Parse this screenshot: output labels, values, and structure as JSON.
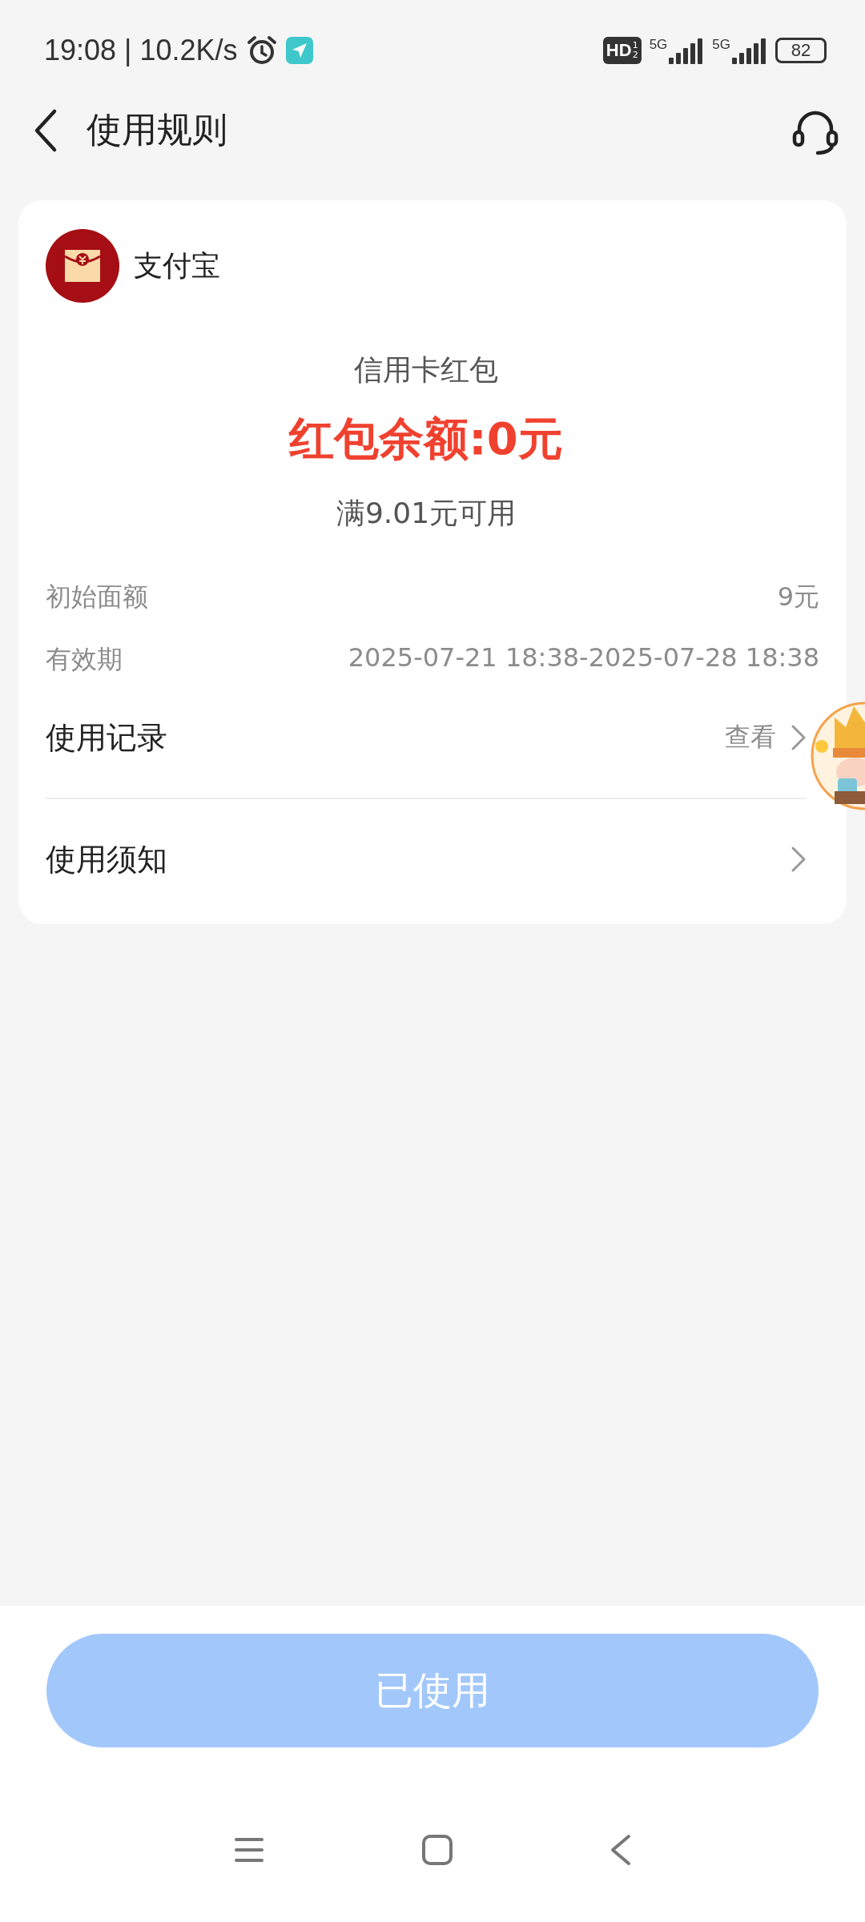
{
  "status_bar": {
    "time": "19:08 | 10.2K/s",
    "hd_badge": {
      "label": "HD",
      "sims": [
        "1",
        "2"
      ]
    },
    "networks": [
      {
        "label": "5G"
      },
      {
        "label": "5G"
      }
    ],
    "battery": "82"
  },
  "header": {
    "title": "使用规则"
  },
  "card": {
    "merchant": "支付宝",
    "coupon_type": "信用卡红包",
    "balance": "红包余额:0元",
    "condition": "满9.01元可用",
    "details": [
      {
        "label": "初始面额",
        "value": "9元"
      },
      {
        "label": "有效期",
        "value": "2025-07-21 18:38-2025-07-28 18:38"
      }
    ],
    "links": [
      {
        "label": "使用记录",
        "action": "查看"
      },
      {
        "label": "使用须知"
      }
    ]
  },
  "action_button": {
    "label": "已使用",
    "disabled": true
  }
}
